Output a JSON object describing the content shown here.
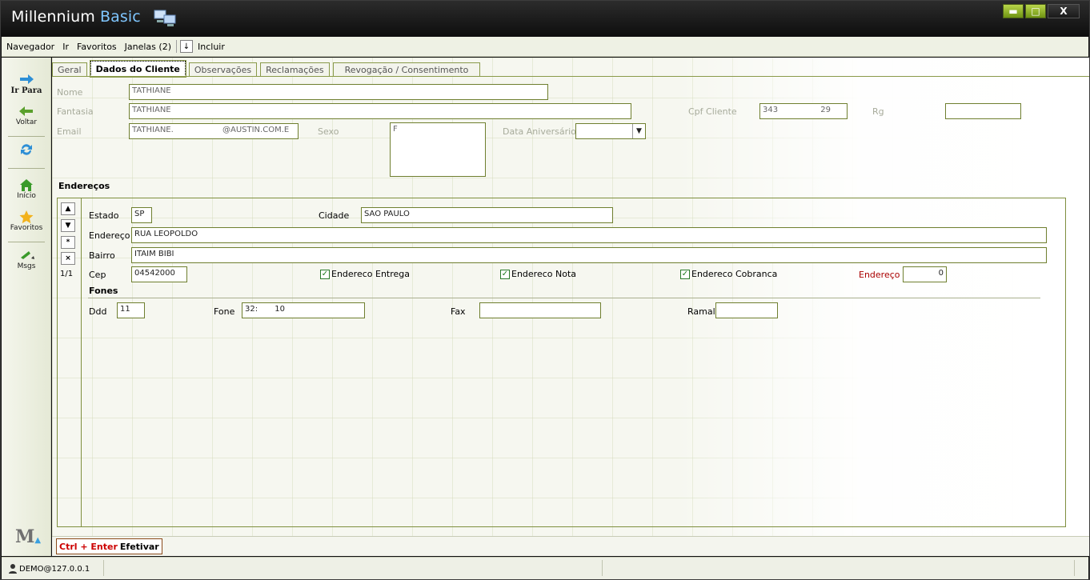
{
  "app": {
    "title_part1": "Millennium",
    "title_part2": "Basic"
  },
  "menu": {
    "items": [
      "Navegador",
      "Ir",
      "Favoritos",
      "Janelas (2)"
    ],
    "incluir": "Incluir"
  },
  "sidebar": {
    "items": [
      {
        "label": "Ir Para",
        "icon": "arrow-right-icon"
      },
      {
        "label": "Voltar",
        "icon": "arrow-left-icon"
      },
      {
        "label": "",
        "icon": "refresh-icon"
      },
      {
        "label": "Início",
        "icon": "home-icon"
      },
      {
        "label": "Favoritos",
        "icon": "star-icon"
      },
      {
        "label": "Msgs",
        "icon": "messages-icon"
      }
    ],
    "logo": "M"
  },
  "tabs": [
    "Geral",
    "Dados do Cliente",
    "Observações",
    "Reclamações",
    "Revogação / Consentimento"
  ],
  "cliente": {
    "nome_label": "Nome",
    "nome": "TATHIANE",
    "fantasia_label": "Fantasia",
    "fantasia": "TATHIANE",
    "email_label": "Email",
    "email_user": "TATHIANE.",
    "email_domain": "@AUSTIN.COM.E",
    "sexo_label": "Sexo",
    "sexo": "F",
    "data_aniversario_label": "Data Aniversário",
    "data_aniversario": "",
    "cpf_label": "Cpf Cliente",
    "cpf_a": "343",
    "cpf_b": "29",
    "rg_label": "Rg",
    "rg": ""
  },
  "enderecos": {
    "title": "Endereços",
    "estado_label": "Estado",
    "estado": "SP",
    "cidade_label": "Cidade",
    "cidade": "SAO PAULO",
    "endereco_label": "Endereço",
    "endereco": "RUA LEOPOLDO",
    "bairro_label": "Bairro",
    "bairro": "ITAIM BIBI",
    "cep_label": "Cep",
    "cep": "04542000",
    "entrega_label": "Endereco Entrega",
    "nota_label": "Endereco Nota",
    "cobranca_label": "Endereco Cobranca",
    "num_label": "Endereço",
    "num": "0",
    "record_count": "1/1",
    "nav": {
      "up": "▲",
      "down": "▼",
      "new": "*",
      "delete": "×"
    }
  },
  "fones": {
    "title": "Fones",
    "ddd_label": "Ddd",
    "ddd": "11",
    "fone_label": "Fone",
    "fone_a": "32:",
    "fone_b": "10",
    "fax_label": "Fax",
    "fax": "",
    "ramal_label": "Ramal",
    "ramal": ""
  },
  "bottom": {
    "shortcut": "Ctrl + Enter",
    "action": "Efetivar"
  },
  "status": {
    "user": "DEMO@127.0.0.1"
  },
  "colors": {
    "accent_green": "#8a9a4a",
    "title_blue": "#7fc6ff",
    "label_red": "#aa0000"
  }
}
